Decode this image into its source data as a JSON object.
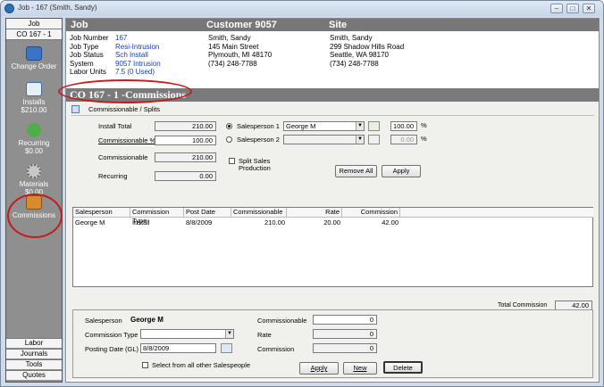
{
  "window": {
    "title": "Job - 167 (Smith, Sandy)"
  },
  "nav": {
    "top_label": "Job",
    "job_label": "CO 167 - 1",
    "items": [
      {
        "label": "Change Order",
        "sub": ""
      },
      {
        "label": "Installs",
        "sub": "$210.00"
      },
      {
        "label": "Recurring",
        "sub": "$0.00"
      },
      {
        "label": "Materials",
        "sub": "$0.00"
      },
      {
        "label": "Commissions",
        "sub": ""
      }
    ],
    "bottom": [
      "Labor",
      "Journals",
      "Tools",
      "Quotes"
    ]
  },
  "header": {
    "job": "Job",
    "customer": "Customer 9057",
    "site": "Site"
  },
  "job_info": {
    "labels": [
      "Job Number",
      "Job Type",
      "Job Status",
      "System",
      "Labor Units"
    ],
    "values": [
      "167",
      "Resi-Intrusion",
      "Sch Install",
      "9057 Intrusion",
      "7.5 (0 Used)"
    ]
  },
  "customer_info": [
    "Smith, Sandy",
    "145 Main Street",
    "Plymouth, MI  48170",
    "(734) 248-7788"
  ],
  "site_info": [
    "Smith, Sandy",
    "299 Shadow Hills Road",
    "Seattle, WA  98170",
    "(734) 248-7788"
  ],
  "co_title": "CO 167 - 1 -Commissions",
  "splits_link": "Commissionable / Splits",
  "form": {
    "install_total_label": "Install Total",
    "install_total": "210.00",
    "commissionable_pct_label": "Commissionable %",
    "commissionable_pct": "100.00",
    "commissionable_label": "Commissionable",
    "commissionable": "210.00",
    "recurring_label": "Recurring",
    "recurring": "0.00",
    "salesperson1_label": "Salesperson 1",
    "salesperson1": "George M",
    "salesperson1_pct": "100.00",
    "salesperson2_label": "Salesperson 2",
    "salesperson2": "",
    "salesperson2_pct": "0.00",
    "pct_sign": "%",
    "split_label_1": "Split Sales",
    "split_label_2": "Production",
    "remove_all": "Remove All",
    "apply": "Apply"
  },
  "table": {
    "columns": [
      "Salesperson",
      "Commission Type",
      "Post Date",
      "Commissionable",
      "Rate",
      "Commission"
    ],
    "rows": [
      [
        "George M",
        "Install",
        "8/8/2009",
        "210.00",
        "20.00",
        "42.00"
      ]
    ],
    "total_label": "Total Commission",
    "total": "42.00"
  },
  "detail": {
    "salesperson_label": "Salesperson",
    "salesperson": "George M",
    "commission_type_label": "Commission Type",
    "commission_type": "",
    "posting_date_label": "Posting Date (GL)",
    "posting_date": "8/8/2009",
    "select_all_label": "Select from all other Salespeople",
    "commissionable_label": "Commissionable",
    "commissionable": "0",
    "rate_label": "Rate",
    "rate": "0",
    "commission_label": "Commission",
    "commission": "0",
    "apply": "Apply",
    "new": "New",
    "delete": "Delete"
  },
  "colors": {
    "annotation": "#c21c1c",
    "link_blue": "#1a3fb5",
    "header_gray": "#777777"
  }
}
